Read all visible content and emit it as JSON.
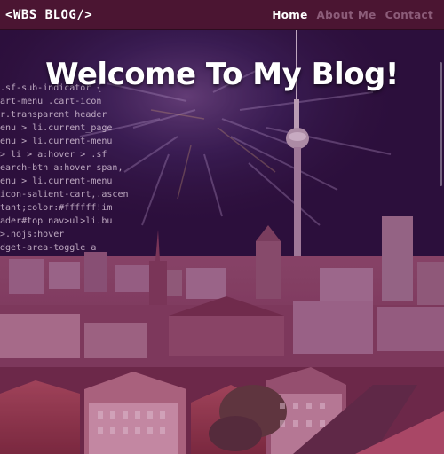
{
  "navbar": {
    "logo": "<WBS BLOG/>",
    "links": [
      {
        "label": "Home",
        "active": true
      },
      {
        "label": "About Me",
        "active": false
      },
      {
        "label": "Contact",
        "active": false
      }
    ]
  },
  "hero": {
    "title": "Welcome To My Blog!",
    "code_lines": [
      ".sf-sub-indicator {",
      "art-menu .cart-icon",
      "r.transparent header",
      "enu > li.current_page",
      "enu > li.current-menu",
      "> li > a:hover > .sf",
      "earch-btn a:hover span,",
      "enu > li.current-menu",
      "icon-salient-cart,.ascen",
      "tant;color:#ffffff!im",
      "ader#top nav>ul>li.bu",
      ">.nojs:hover",
      "dget-area-toggle a"
    ]
  }
}
